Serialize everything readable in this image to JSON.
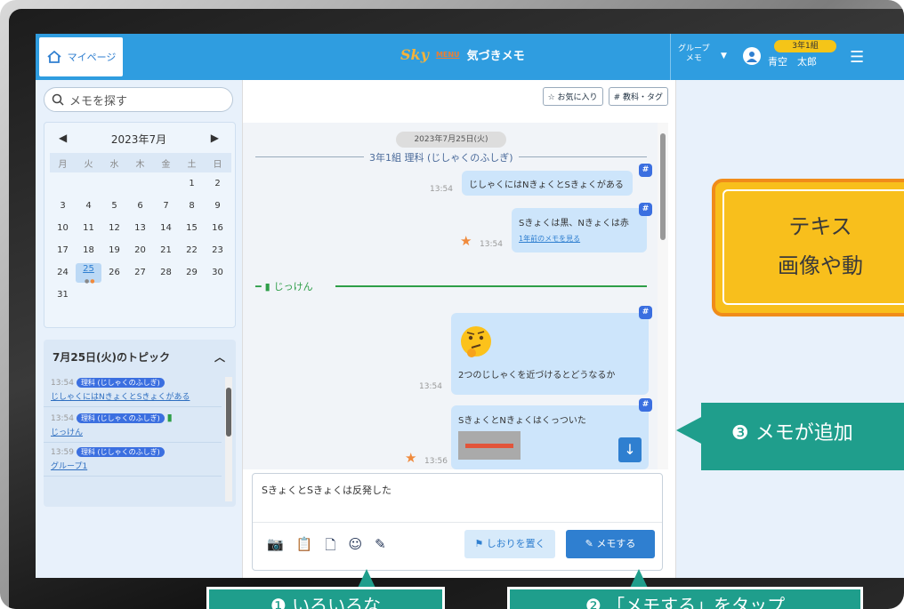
{
  "topbar": {
    "home_label": "マイページ",
    "app_name": "気づきメモ",
    "logo_text": "Sky",
    "logo_sub": "MENU",
    "group_menu_line1": "グループ",
    "group_menu_line2": "メモ",
    "class_badge": "3年1組",
    "user_name": "青空　太郎"
  },
  "search": {
    "placeholder": "メモを探す"
  },
  "calendar": {
    "month": "2023年7月",
    "weekdays": [
      "月",
      "火",
      "水",
      "木",
      "金",
      "土",
      "日"
    ],
    "weeks": [
      [
        "",
        "",
        "",
        "",
        "",
        "1",
        "2"
      ],
      [
        "3",
        "4",
        "5",
        "6",
        "7",
        "8",
        "9"
      ],
      [
        "10",
        "11",
        "12",
        "13",
        "14",
        "15",
        "16"
      ],
      [
        "17",
        "18",
        "19",
        "20",
        "21",
        "22",
        "23"
      ],
      [
        "24",
        "25",
        "26",
        "27",
        "28",
        "29",
        "30"
      ],
      [
        "31",
        "",
        "",
        "",
        "",
        "",
        ""
      ]
    ],
    "selected": "25"
  },
  "topics": {
    "title": "7月25日(火)のトピック",
    "items": [
      {
        "time": "13:54",
        "subject": "理科 (じしゃくのふしぎ)",
        "text": "じしゃくにはNきょくとSきょくがある"
      },
      {
        "time": "13:54",
        "subject": "理科 (じしゃくのふしぎ)",
        "text": "じっけん"
      },
      {
        "time": "13:59",
        "subject": "理科 (じしゃくのふしぎ)",
        "text": "グループ1"
      }
    ]
  },
  "toolbar": {
    "favorites": "お気に入り",
    "subject_tag": "教科・タグ"
  },
  "chat": {
    "date": "2023年7月25日(火)",
    "class_label": "3年1組 理科 (じしゃくのふしぎ)",
    "bookmark_label": "じっけん",
    "messages": [
      {
        "time": "13:54",
        "text": "じしゃくにはNきょくとSきょくがある"
      },
      {
        "time": "13:54",
        "text": "Sきょくは黒、Nきょくは赤",
        "link": "1年前のメモを見る"
      },
      {
        "time": "13:54",
        "text": "2つのじしゃくを近づけるとどうなるか"
      },
      {
        "time": "13:56",
        "text": "SきょくとNきょくはくっついた"
      }
    ]
  },
  "input": {
    "value": "SきょくとSきょくは反発した",
    "bookmark_button": "しおりを置く",
    "memo_button": "メモする"
  },
  "callouts": {
    "yellow_line1": "テキス",
    "yellow_line2": "画像や動",
    "teal_text": "メモが追加",
    "teal_num": "❸",
    "bottom_left": "❶ いろいろな",
    "bottom_right": "❷ 「メモする」をタップ"
  },
  "colors": {
    "brand_blue": "#2f9de0",
    "accent_yellow": "#f8bf1c",
    "callout_teal": "#1f9e8c"
  }
}
